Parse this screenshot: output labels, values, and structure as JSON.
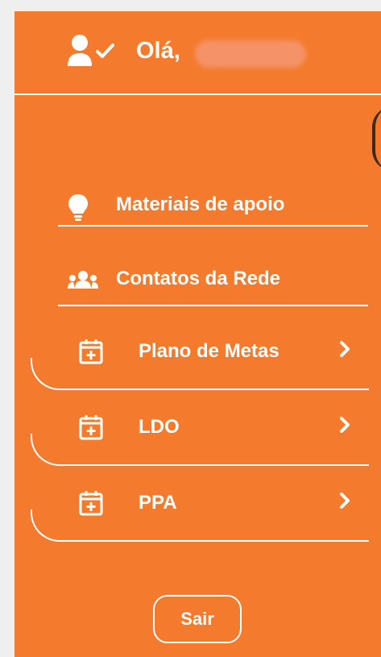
{
  "header": {
    "greeting": "Olá,"
  },
  "menu": [
    {
      "label": "Materiais de apoio",
      "icon": "lightbulb-icon"
    },
    {
      "label": "Contatos da Rede",
      "icon": "users-icon"
    }
  ],
  "submenus": [
    {
      "label": "Plano de Metas",
      "icon": "calendar-plus-icon"
    },
    {
      "label": "LDO",
      "icon": "calendar-plus-icon"
    },
    {
      "label": "PPA",
      "icon": "calendar-plus-icon"
    }
  ],
  "logout_label": "Sair",
  "colors": {
    "background": "#f47b2e",
    "text": "#ffffff"
  }
}
